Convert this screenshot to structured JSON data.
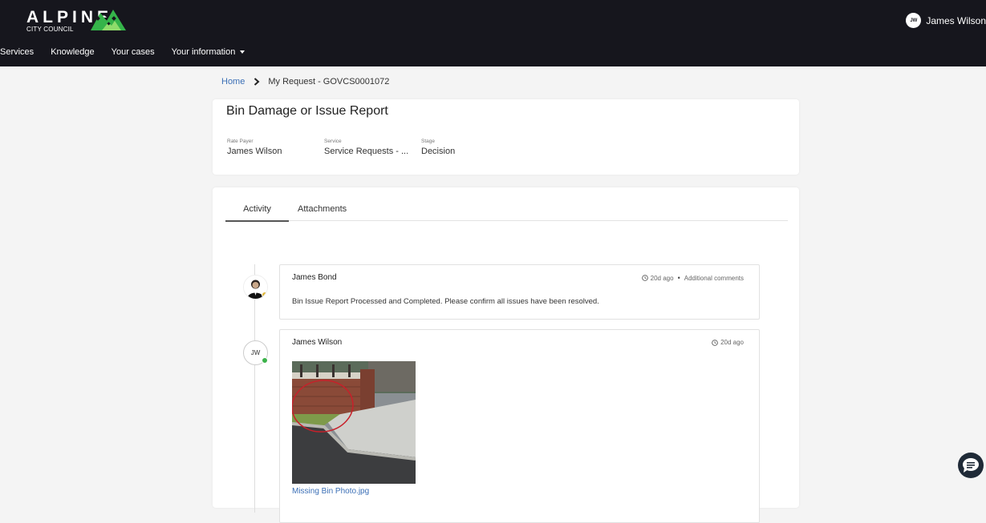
{
  "header": {
    "logo_word": "ALPINE",
    "logo_sub": "CITY COUNCIL",
    "user_initials": "JW",
    "user_name": "James Wilson",
    "nav": [
      "Services",
      "Knowledge",
      "Your cases",
      "Your information"
    ]
  },
  "breadcrumb": {
    "home": "Home",
    "current": "My Request - GOVCS0001072"
  },
  "case": {
    "title": "Bin Damage or Issue Report",
    "fields": [
      {
        "label": "Rate Payer",
        "value": "James Wilson"
      },
      {
        "label": "Service",
        "value": "Service Requests - ..."
      },
      {
        "label": "Stage",
        "value": "Decision"
      }
    ]
  },
  "tabs": {
    "activity": "Activity",
    "attachments": "Attachments"
  },
  "activity": [
    {
      "author": "James Bond",
      "time": "20d ago",
      "type": "Additional comments",
      "text": "Bin Issue Report Processed and Completed. Please confirm all issues have been resolved."
    },
    {
      "author": "James Wilson",
      "initials": "JW",
      "time": "20d ago",
      "attachment_name": "Missing Bin Photo.jpg"
    }
  ],
  "colors": {
    "header_bg": "#16161d",
    "link": "#3b6fb6",
    "online": "#3bb24a",
    "logo_green": "#35b44a"
  }
}
